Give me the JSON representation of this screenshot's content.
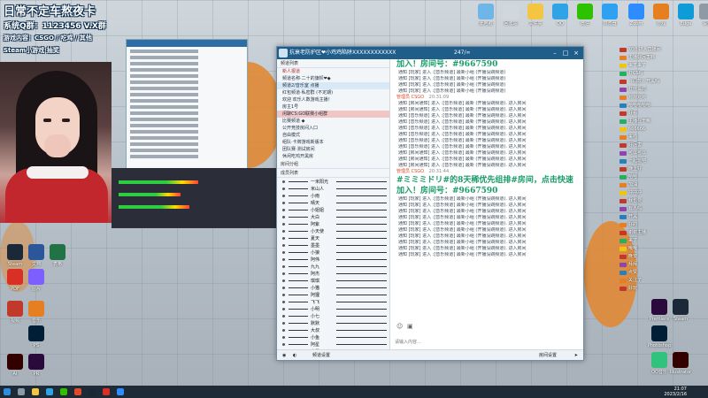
{
  "overlay": {
    "line1": "日常不定车熬夜卡",
    "line2": "系统Q群：1123456 V.X群",
    "line3": "游戏内容：CSGO / 吃鸡 / 其他",
    "line4": "Steam小游戏·抽奖"
  },
  "main_window": {
    "title": "抗衰老防护区❤小鸡鸡陷阱XXXXXXXXXXXX",
    "members_count": "247/∞",
    "left_panel": {
      "header": "频道列表",
      "search_label": "新人报道",
      "channels": [
        {
          "label": "频道名称·二十的旗帜❤◆",
          "style": "normal"
        },
        {
          "label": "频道2/音乐室 点播",
          "style": "sel"
        },
        {
          "label": "红包频道·私密群 (不定期)",
          "style": "normal"
        },
        {
          "label": "欢迎 欢乐人数游戏主播！",
          "style": "normal"
        },
        {
          "label": "房主1号",
          "style": "normal"
        },
        {
          "label": "闲聊CS:GO联赛小组群",
          "style": "hl"
        },
        {
          "label": "比赛频道 ◆",
          "style": "normal"
        },
        {
          "label": "公开竞技房间入口",
          "style": "normal"
        },
        {
          "label": "自由模式",
          "style": "normal"
        },
        {
          "label": "组队·卡牌游戏新版本",
          "style": "normal"
        },
        {
          "label": "团队赛·测试房间",
          "style": "normal"
        },
        {
          "label": "休闲吃鸡开黑房",
          "style": "normal"
        }
      ],
      "section_label": "房间分组",
      "members_section": "成员列表",
      "members": [
        "一米阳光",
        "米山人",
        "小雨",
        "晴天",
        "小姐姐",
        "大白",
        "阿紫",
        "小天使",
        "夏天",
        "墨墨",
        "小狼",
        "阿伟",
        "九九",
        "阿杰",
        "琪琪",
        "小猫",
        "阿狸",
        "飞飞",
        "小明",
        "小七",
        "默默",
        "大叔",
        "小鱼",
        "阿星",
        "小黑"
      ]
    },
    "messages_top": [
      "通知 [玩家] 进入 :[音乐频道] 最新小组 (开播没跳频道)",
      "通知 [玩家] 进入 :[音乐频道] 最新小组 (开播没跳频道)",
      "通知 [玩家] 进入 :[音乐频道] 最新小组 (开播没跳频道)",
      "通知 [玩家] 进入 :[音乐频道] 最新小组 (开播没跳频道)"
    ],
    "big_announce": "加入！房间号：#9667590",
    "sender_line": "管理员 CSGO",
    "sender_time": "20:31:09",
    "mid_messages": [
      "通知 [房间通知] 进入 :[音乐频道] 最新 (开播没跳频道). 进入房间",
      "通知 [房间通知] 进入 :[音乐频道] 最新 (开播没跳频道). 进入房间",
      "通知 [音乐频道] 进入 :[音乐频道] 最新 (开播没跳频道). 进入房间",
      "通知 [音乐频道] 进入 :[音乐频道] 最新 (开播没跳频道). 进入房间",
      "通知 [音乐频道] 进入 :[音乐频道] 最新 (开播没跳频道). 进入房间",
      "通知 [音乐频道] 进入 :[音乐频道] 最新 (开播没跳频道). 进入房间",
      "通知 [音乐频道] 进入 :[音乐频道] 最新 (开播没跳频道). 进入房间",
      "通知 [音乐频道] 进入 :[音乐频道] 最新 (开播没跳频道). 进入房间",
      "通知 [房间通知] 进入 :[音乐频道] 最新 (开播没跳频道). 进入房间",
      "通知 [房间通知] 进入 :[音乐频道] 最新 (开播没跳频道). 进入房间",
      "通知 [房间通知] 进入 :[音乐频道] 最新 (开播没跳频道). 进入房间"
    ],
    "sender2": "管理员 CSGO",
    "sender2_time": "20:31:44",
    "big_announce2_a": "#ミミミドリ#的8天稀优先组排#房间，点击快速",
    "big_announce2_b": "加入！房间号：#9667590",
    "bottom_messages": [
      "通知 [玩家] 进入 :[音乐频道] 最新小组 (开播没跳频道). 进入房间",
      "通知 [玩家] 进入 :[音乐频道] 最新小组 (开播没跳频道). 进入房间",
      "通知 [玩家] 进入 :[音乐频道] 最新小组 (开播没跳频道). 进入房间",
      "通知 [玩家] 进入 :[音乐频道] 最新小组 (开播没跳频道). 进入房间",
      "通知 [玩家] 进入 :[音乐频道] 最新小组 (开播没跳频道). 进入房间",
      "通知 [玩家] 进入 :[音乐频道] 最新小组 (开播没跳频道). 进入房间",
      "通知 [玩家] 进入 :[音乐频道] 最新小组 (开播没跳频道). 进入房间",
      "通知 [玩家] 进入 :[音乐频道] 最新小组 (开播没跳频道). 进入房间",
      "通知 [玩家] 进入 :[音乐频道] 最新小组 (开播没跳频道). 进入房间",
      "通知 [玩家] 进入 :[音乐频道] 最新小组 (开播没跳频道). 进入房间"
    ],
    "input_placeholder": "请输入内容…",
    "bottom_bar": {
      "left": "频道设置",
      "right": "房间设置"
    }
  },
  "right_chat": [
    {
      "text": "欢迎 进入直播间",
      "badge": "#c0392b"
    },
    {
      "text": "主播好厉害啊",
      "badge": "#e67e22"
    },
    {
      "text": "来了来了",
      "badge": "#f1c40f"
    },
    {
      "text": "打CS吗",
      "badge": "#27ae60"
    },
    {
      "text": "《同款》开黑吗",
      "badge": "#c0392b"
    },
    {
      "text": "打什么局",
      "badge": "#8e44ad"
    },
    {
      "text": "对对对对",
      "badge": "#e67e22"
    },
    {
      "text": "哈哈哈哈哈",
      "badge": "#2980b9"
    },
    {
      "text": "好看",
      "badge": "#c0392b"
    },
    {
      "text": "主播在干嘛",
      "badge": "#27ae60"
    },
    {
      "text": "666666",
      "badge": "#f1c40f"
    },
    {
      "text": "来啦",
      "badge": "#e67e22"
    },
    {
      "text": "好厉害",
      "badge": "#c0392b"
    },
    {
      "text": "可以可以",
      "badge": "#8e44ad"
    },
    {
      "text": "一起玩吧",
      "badge": "#2980b9"
    },
    {
      "text": "晚上好",
      "badge": "#c0392b"
    },
    {
      "text": "哈哈",
      "badge": "#27ae60"
    },
    {
      "text": "加油",
      "badge": "#e67e22"
    },
    {
      "text": "冲冲冲",
      "badge": "#f1c40f"
    },
    {
      "text": "我也要",
      "badge": "#c0392b"
    },
    {
      "text": "有人吗",
      "badge": "#8e44ad"
    },
    {
      "text": "开黑",
      "badge": "#2980b9"
    },
    {
      "text": "好的",
      "badge": "#e67e22"
    },
    {
      "text": "谢谢主播",
      "badge": "#c0392b"
    },
    {
      "text": "来了",
      "badge": "#27ae60"
    },
    {
      "text": "哦哦",
      "badge": "#f1c40f"
    },
    {
      "text": "晚安",
      "badge": "#c0392b"
    },
    {
      "text": "拜拜",
      "badge": "#8e44ad"
    },
    {
      "text": "点赞",
      "badge": "#2980b9"
    },
    {
      "text": "关注了",
      "badge": "#e67e22"
    },
    {
      "text": "好玩",
      "badge": "#c0392b"
    }
  ],
  "desktop_icons_top": [
    {
      "label": "此电脑",
      "color": "#6fb6e8"
    },
    {
      "label": "回收站",
      "color": "#d0d7de"
    },
    {
      "label": "文件夹",
      "color": "#f4c542"
    },
    {
      "label": "QQ",
      "color": "#2fa3e6"
    },
    {
      "label": "微信",
      "color": "#2dc100"
    },
    {
      "label": "浏览器",
      "color": "#2ea1f2"
    },
    {
      "label": "Zoom",
      "color": "#2d8cff"
    },
    {
      "label": "游戏",
      "color": "#e67e22"
    },
    {
      "label": "Edge",
      "color": "#0f9bd7"
    },
    {
      "label": "设置",
      "color": "#8e9aa6"
    }
  ],
  "desktop_icons_left": [
    {
      "label": "Steam",
      "color": "#1b2838"
    },
    {
      "label": "文档",
      "color": "#2b579a"
    },
    {
      "label": "表格",
      "color": "#217346"
    },
    {
      "label": "PDF",
      "color": "#d93025"
    },
    {
      "label": "图片",
      "color": "#7d5fff"
    },
    {
      "label": "视频",
      "color": "#c0392b"
    },
    {
      "label": "音乐",
      "color": "#e67e22"
    },
    {
      "label": "PS",
      "color": "#001e36"
    },
    {
      "label": "AI",
      "color": "#330000"
    },
    {
      "label": "PR",
      "color": "#2a0a3a"
    }
  ],
  "desktop_icons_right": [
    {
      "label": "Premiere",
      "color": "#2a0a3a"
    },
    {
      "label": "Steam",
      "color": "#1b2838"
    },
    {
      "label": "Photoshop",
      "color": "#001e36"
    },
    {
      "label": "Illustrator",
      "color": "#330000"
    },
    {
      "label": "QQ音乐",
      "color": "#31c27c"
    }
  ],
  "taskbar": {
    "time": "21:07",
    "date": "2023/2/16"
  }
}
